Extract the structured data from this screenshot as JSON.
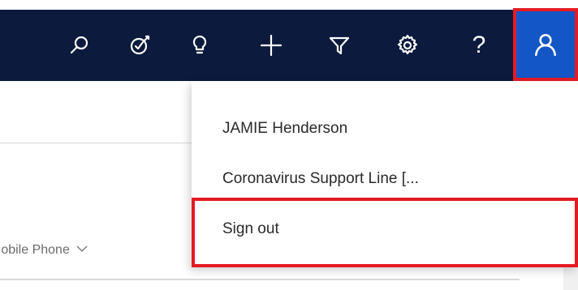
{
  "nav": {
    "icons": [
      "search-icon",
      "target-icon",
      "lightbulb-icon",
      "plus-icon",
      "filter-icon",
      "gear-icon",
      "help-icon",
      "user-icon"
    ],
    "help_label": "?"
  },
  "menu": {
    "user_name": "JAMIE Henderson",
    "organization": "Coronavirus Support Line [...",
    "sign_out": "Sign out"
  },
  "page": {
    "column_header": "Mobile Phone"
  },
  "colors": {
    "topbar": "#0b1a3d",
    "profile_active": "#1357c7",
    "highlight": "#e51b23"
  }
}
